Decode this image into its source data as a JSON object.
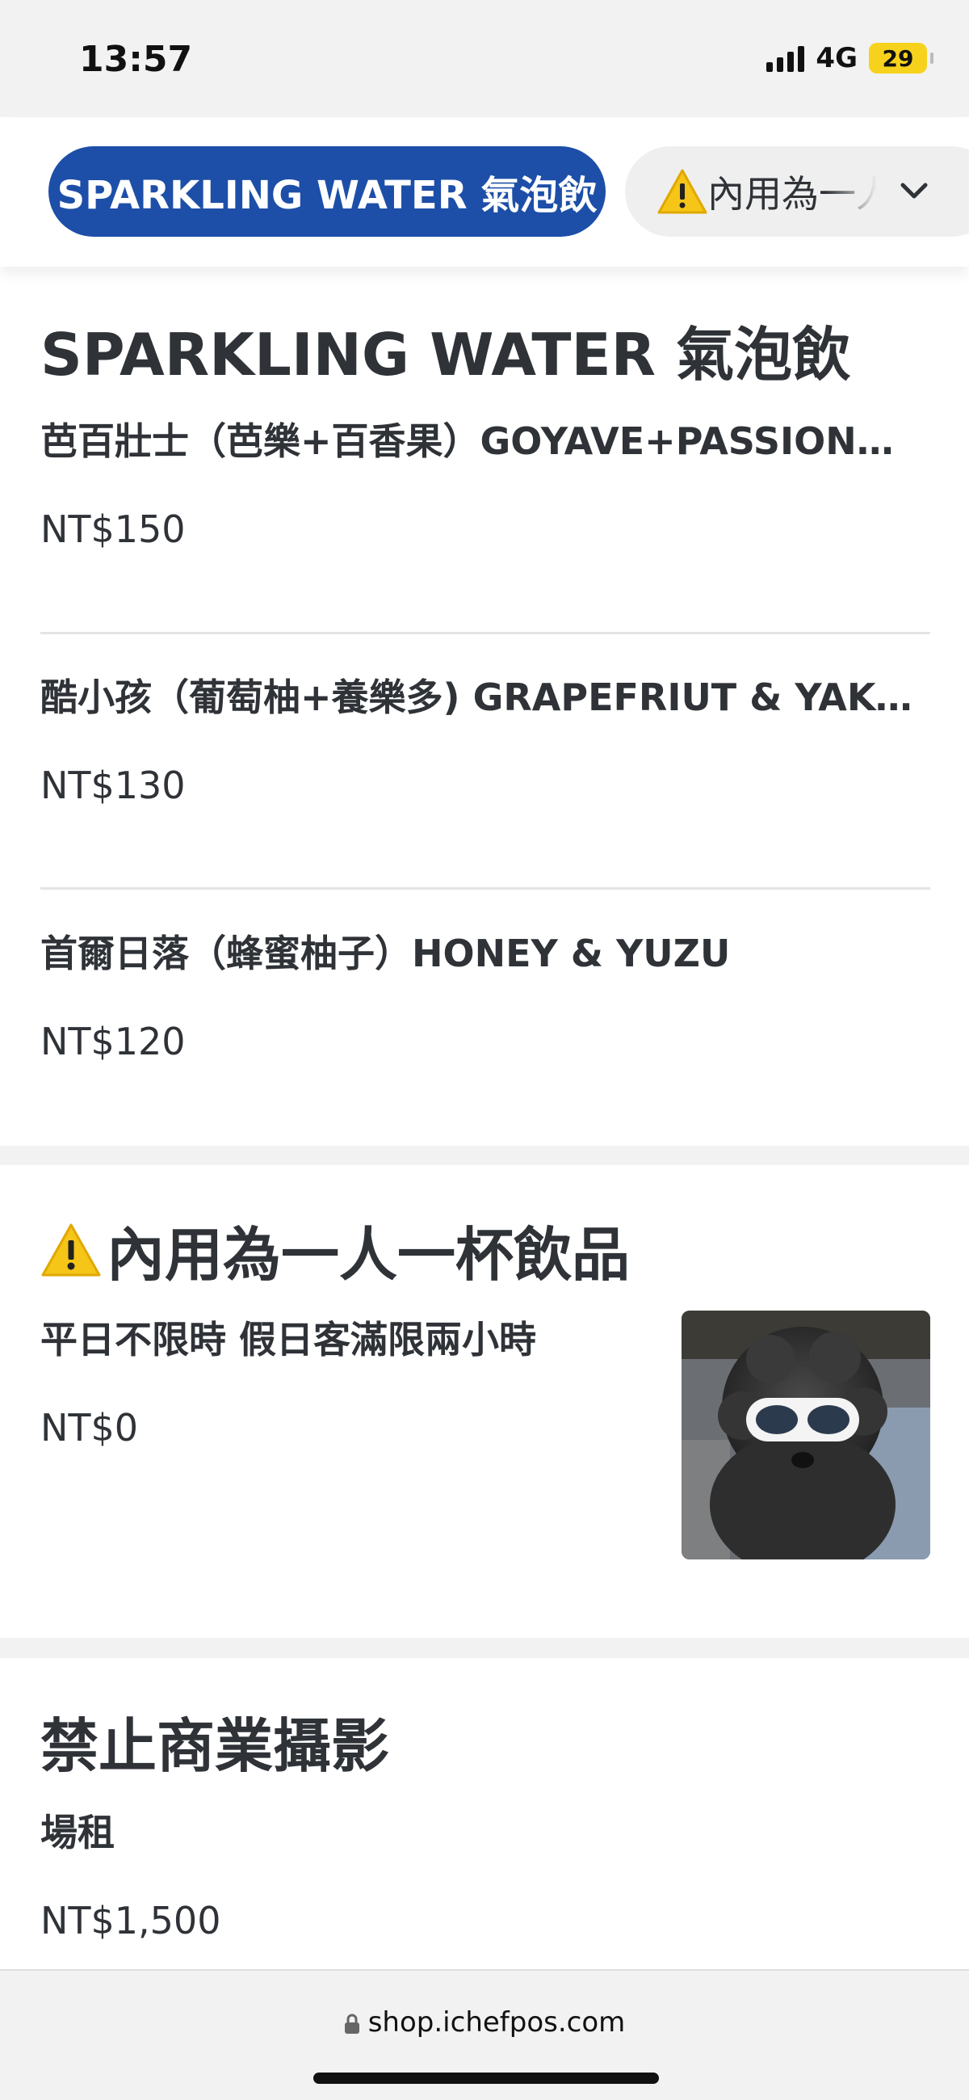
{
  "status_bar": {
    "time": "13:57",
    "network": "4G",
    "battery": "29"
  },
  "category_bar": {
    "active_pill": "SPARKLING WATER 氣泡飲",
    "dropdown_label": "內用為一人一杯飲品",
    "dropdown_icon": "warning-icon"
  },
  "section1": {
    "title": "SPARKLING WATER 氣泡飲",
    "items": [
      {
        "name": "芭百壯士（芭樂+百香果）GOYAVE+PASSION FRUIT",
        "price": "NT$150"
      },
      {
        "name": "酷小孩（葡萄柚+養樂多) GRAPEFRIUT & YAKULT",
        "price": "NT$130"
      },
      {
        "name": "首爾日落（蜂蜜柚子）HONEY & YUZU",
        "price": "NT$120"
      }
    ]
  },
  "section2": {
    "title": "內用為一人一杯飲品",
    "title_icon": "warning-icon",
    "items": [
      {
        "name": "平日不限時 假日客滿限兩小時",
        "price": "NT$0",
        "image": "dog-with-goggles-photo"
      }
    ]
  },
  "section3": {
    "title": "禁止商業攝影",
    "items": [
      {
        "name": "場租",
        "price": "NT$1,500"
      }
    ]
  },
  "browser": {
    "url": "shop.ichefpos.com"
  },
  "colors": {
    "primary": "#1d4fa8",
    "text": "#2f3338",
    "warning": "#f5c518",
    "divider": "#e4e4e4"
  }
}
